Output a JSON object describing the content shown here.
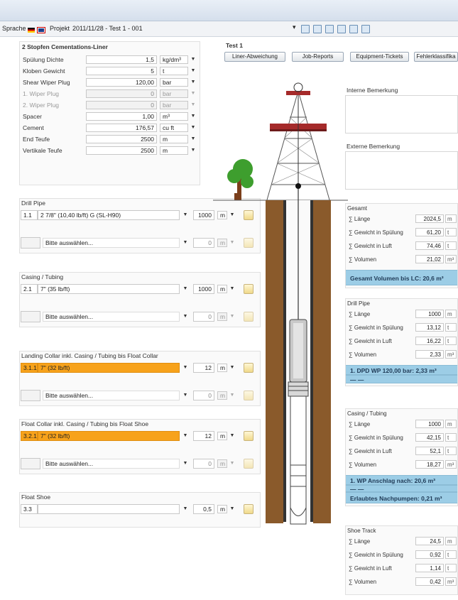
{
  "toolbar": {
    "language_label": "Sprache",
    "project_label": "Projekt",
    "project_value": "2011/11/28 - Test 1 - 001"
  },
  "params": {
    "title": "2 Stopfen Cementations-Liner",
    "rows": [
      {
        "label": "Spülung Dichte",
        "value": "1,5",
        "unit": "kg/dm³"
      },
      {
        "label": "Kloben Gewicht",
        "value": "5",
        "unit": "t"
      },
      {
        "label": "Shear Wiper Plug",
        "value": "120,00",
        "unit": "bar"
      },
      {
        "label": "1. Wiper Plug",
        "value": "0",
        "unit": "bar"
      },
      {
        "label": "2. Wiper Plug",
        "value": "0",
        "unit": "bar"
      },
      {
        "label": "Spacer",
        "value": "1,00",
        "unit": "m³"
      },
      {
        "label": "Cement",
        "value": "176,57",
        "unit": "cu ft"
      },
      {
        "label": "End Teufe",
        "value": "2500",
        "unit": "m"
      },
      {
        "label": "Vertikale Teufe",
        "value": "2500",
        "unit": "m"
      }
    ]
  },
  "sections": {
    "drill_pipe": {
      "title": "Drill Pipe",
      "row1": {
        "id": "1.1",
        "desc": "2 7/8\" (10,40 lb/ft) G (SL-H90)",
        "len": "1000",
        "unit": "m"
      },
      "row2": {
        "desc": "Bitte auswählen...",
        "len": "0",
        "unit": "m"
      }
    },
    "casing": {
      "title": "Casing / Tubing",
      "row1": {
        "id": "2.1",
        "desc": "7\" (35 lb/ft)",
        "len": "1000",
        "unit": "m"
      },
      "row2": {
        "desc": "Bitte auswählen...",
        "len": "0",
        "unit": "m"
      }
    },
    "landing": {
      "title": "Landing Collar inkl. Casing / Tubing bis Float Collar",
      "row1": {
        "id": "3.1.1",
        "desc": "7\" (32 lb/ft)",
        "len": "12",
        "unit": "m"
      },
      "row2": {
        "desc": "Bitte auswählen...",
        "len": "0",
        "unit": "m"
      }
    },
    "float_collar": {
      "title": "Float Collar inkl. Casing / Tubing bis Float Shoe",
      "row1": {
        "id": "3.2.1",
        "desc": "7\" (32 lb/ft)",
        "len": "12",
        "unit": "m"
      },
      "row2": {
        "desc": "Bitte auswählen...",
        "len": "0",
        "unit": "m"
      }
    },
    "float_shoe": {
      "title": "Float Shoe",
      "row1": {
        "id": "3.3",
        "desc": "",
        "len": "0,5",
        "unit": "m"
      }
    }
  },
  "center": {
    "title": "Test 1",
    "buttons": [
      "Liner-Abweichung",
      "Job-Reports",
      "Equipment-Tickets",
      "Fehlerklassifika"
    ]
  },
  "right": {
    "interne": "Interne Bemerkung",
    "externe": "Externe Bemerkung",
    "gesamt": {
      "title": "Gesamt",
      "rows": [
        {
          "label": "∑ Länge",
          "value": "2024,5",
          "unit": "m"
        },
        {
          "label": "∑ Gewicht in Spülung",
          "value": "61,20",
          "unit": "t"
        },
        {
          "label": "∑ Gewicht in Luft",
          "value": "74,46",
          "unit": "t"
        },
        {
          "label": "∑ Volumen",
          "value": "21,02",
          "unit": "m³"
        }
      ],
      "bar": "Gesamt Volumen bis LC: 20,6 m³"
    },
    "drill_pipe": {
      "title": "Drill Pipe",
      "rows": [
        {
          "label": "∑ Länge",
          "value": "1000",
          "unit": "m"
        },
        {
          "label": "∑ Gewicht in Spülung",
          "value": "13,12",
          "unit": "t"
        },
        {
          "label": "∑ Gewicht in Luft",
          "value": "16,22",
          "unit": "t"
        },
        {
          "label": "∑ Volumen",
          "value": "2,33",
          "unit": "m³"
        }
      ],
      "bar1": "1. DPD WP 120,00 bar:  2,33 m³",
      "bar2": "—                                 —"
    },
    "casing": {
      "title": "Casing / Tubing",
      "rows": [
        {
          "label": "∑ Länge",
          "value": "1000",
          "unit": "m"
        },
        {
          "label": "∑ Gewicht in Spülung",
          "value": "42,15",
          "unit": "t"
        },
        {
          "label": "∑ Gewicht in Luft",
          "value": "52,1",
          "unit": "t"
        },
        {
          "label": "∑ Volumen",
          "value": "18,27",
          "unit": "m³"
        }
      ],
      "bar1": "1. WP Anschlag nach:   20,6 m³",
      "bar2": "—                                 —",
      "bar3": "Erlaubtes Nachpumpen:  0,21 m³"
    },
    "shoe_track": {
      "title": "Shoe Track",
      "rows": [
        {
          "label": "∑ Länge",
          "value": "24,5",
          "unit": "m"
        },
        {
          "label": "∑ Gewicht in Spülung",
          "value": "0,92",
          "unit": "t"
        },
        {
          "label": "∑ Gewicht in Luft",
          "value": "1,14",
          "unit": "t"
        },
        {
          "label": "∑ Volumen",
          "value": "0,42",
          "unit": "m³"
        }
      ]
    }
  },
  "colors": {
    "orange": "#f7a21b",
    "blue_bar": "#9ccde6",
    "earth": "#8a5a2b",
    "derrick_red": "#a52a2a",
    "tree": "#3e9e2e"
  }
}
